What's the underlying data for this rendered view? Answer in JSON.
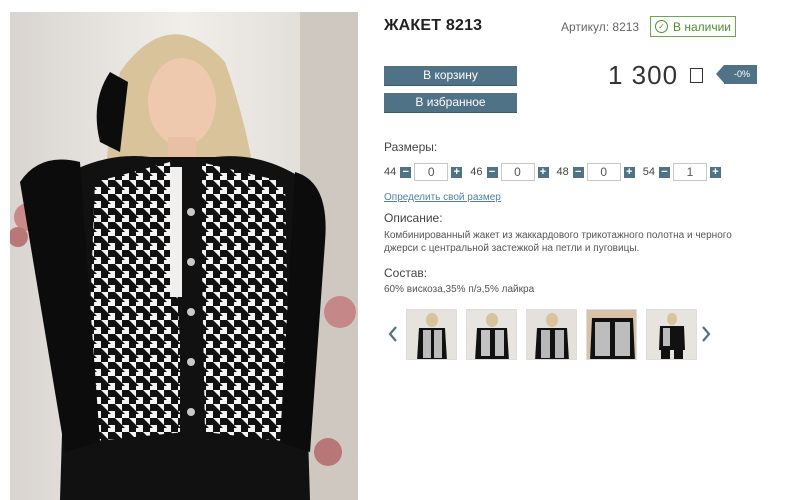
{
  "product": {
    "title": "ЖАКЕТ 8213",
    "article": "Артикул: 8213",
    "stock": "В наличии",
    "price": "1 300",
    "discount": "-0%"
  },
  "buttons": {
    "cart": "В корзину",
    "favorites": "В избранное"
  },
  "sizes": {
    "label": "Размеры:",
    "items": [
      {
        "size": "44",
        "qty": "0"
      },
      {
        "size": "46",
        "qty": "0"
      },
      {
        "size": "48",
        "qty": "0"
      },
      {
        "size": "54",
        "qty": "1"
      }
    ],
    "minus": "−",
    "plus": "+",
    "size_link": "Определить свой размер"
  },
  "description": {
    "label": "Описание:",
    "text": "Комбинированный жакет из жаккардового трикотажного полотна и черного джерси с центральной застежкой на петли и пуговицы."
  },
  "composition": {
    "label": "Состав:",
    "text": "60% вискоза,35% п/э,5% лайкра"
  },
  "colors": {
    "accent": "#4f7286",
    "stock_green": "#4e8f33",
    "link": "#4f7fa6"
  },
  "icons": {
    "stock": "check-circle-icon",
    "currency": "ruble-icon",
    "prev": "chevron-left-icon",
    "next": "chevron-right-icon"
  },
  "gallery": {
    "thumbnail_count": 5
  }
}
